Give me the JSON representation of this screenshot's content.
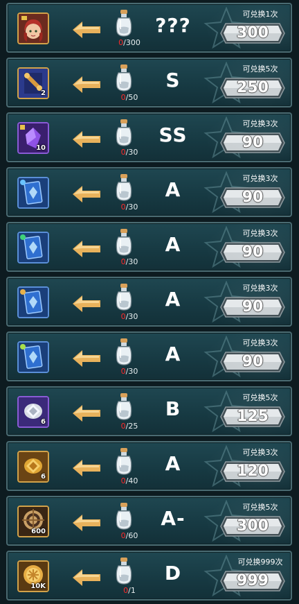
{
  "rows": [
    {
      "item_icon": "hero-portrait-icon",
      "item_count": "",
      "progress_current": "0",
      "progress_total": "/300",
      "grade": "???",
      "exchange_label": "可兑换1次",
      "price": "300"
    },
    {
      "item_icon": "scroll-icon",
      "item_count": "2",
      "progress_current": "0",
      "progress_total": "/50",
      "grade": "S",
      "exchange_label": "可兑换5次",
      "price": "250"
    },
    {
      "item_icon": "purple-crystal-fragment-icon",
      "item_count": "10",
      "progress_current": "0",
      "progress_total": "/30",
      "grade": "SS",
      "exchange_label": "可兑换3次",
      "price": "90"
    },
    {
      "item_icon": "blue-card-icon",
      "item_count": "",
      "progress_current": "0",
      "progress_total": "/30",
      "grade": "A",
      "exchange_label": "可兑换3次",
      "price": "90"
    },
    {
      "item_icon": "blue-card-green-gem-icon",
      "item_count": "",
      "progress_current": "0",
      "progress_total": "/30",
      "grade": "A",
      "exchange_label": "可兑换3次",
      "price": "90"
    },
    {
      "item_icon": "blue-card-gold-gem-icon",
      "item_count": "",
      "progress_current": "0",
      "progress_total": "/30",
      "grade": "A",
      "exchange_label": "可兑换3次",
      "price": "90"
    },
    {
      "item_icon": "blue-card-lime-gem-icon",
      "item_count": "",
      "progress_current": "0",
      "progress_total": "/30",
      "grade": "A",
      "exchange_label": "可兑换3次",
      "price": "90"
    },
    {
      "item_icon": "silver-gem-icon",
      "item_count": "6",
      "progress_current": "0",
      "progress_total": "/25",
      "grade": "B",
      "exchange_label": "可兑换5次",
      "price": "125"
    },
    {
      "item_icon": "gold-gem-icon",
      "item_count": "6",
      "progress_current": "0",
      "progress_total": "/40",
      "grade": "A",
      "exchange_label": "可兑换3次",
      "price": "120"
    },
    {
      "item_icon": "gear-coin-icon",
      "item_count": "600",
      "progress_current": "0",
      "progress_total": "/60",
      "grade": "A-",
      "exchange_label": "可兑换5次",
      "price": "300"
    },
    {
      "item_icon": "gold-coin-icon",
      "item_count": "10K",
      "progress_current": "0",
      "progress_total": "/1",
      "grade": "D",
      "exchange_label": "可兑换999次",
      "price": "999"
    }
  ],
  "colors": {
    "row_bg": "#1f4751",
    "row_border": "#4a6b72",
    "slot_border_gold": "#d2a24a",
    "slot_border_purple": "#8a5bd6",
    "slot_border_blue": "#5a8fd8",
    "progress_red": "#ff2a2a",
    "arrow_gold": "#e8b25c",
    "price_silver": "#c9cfd2"
  }
}
